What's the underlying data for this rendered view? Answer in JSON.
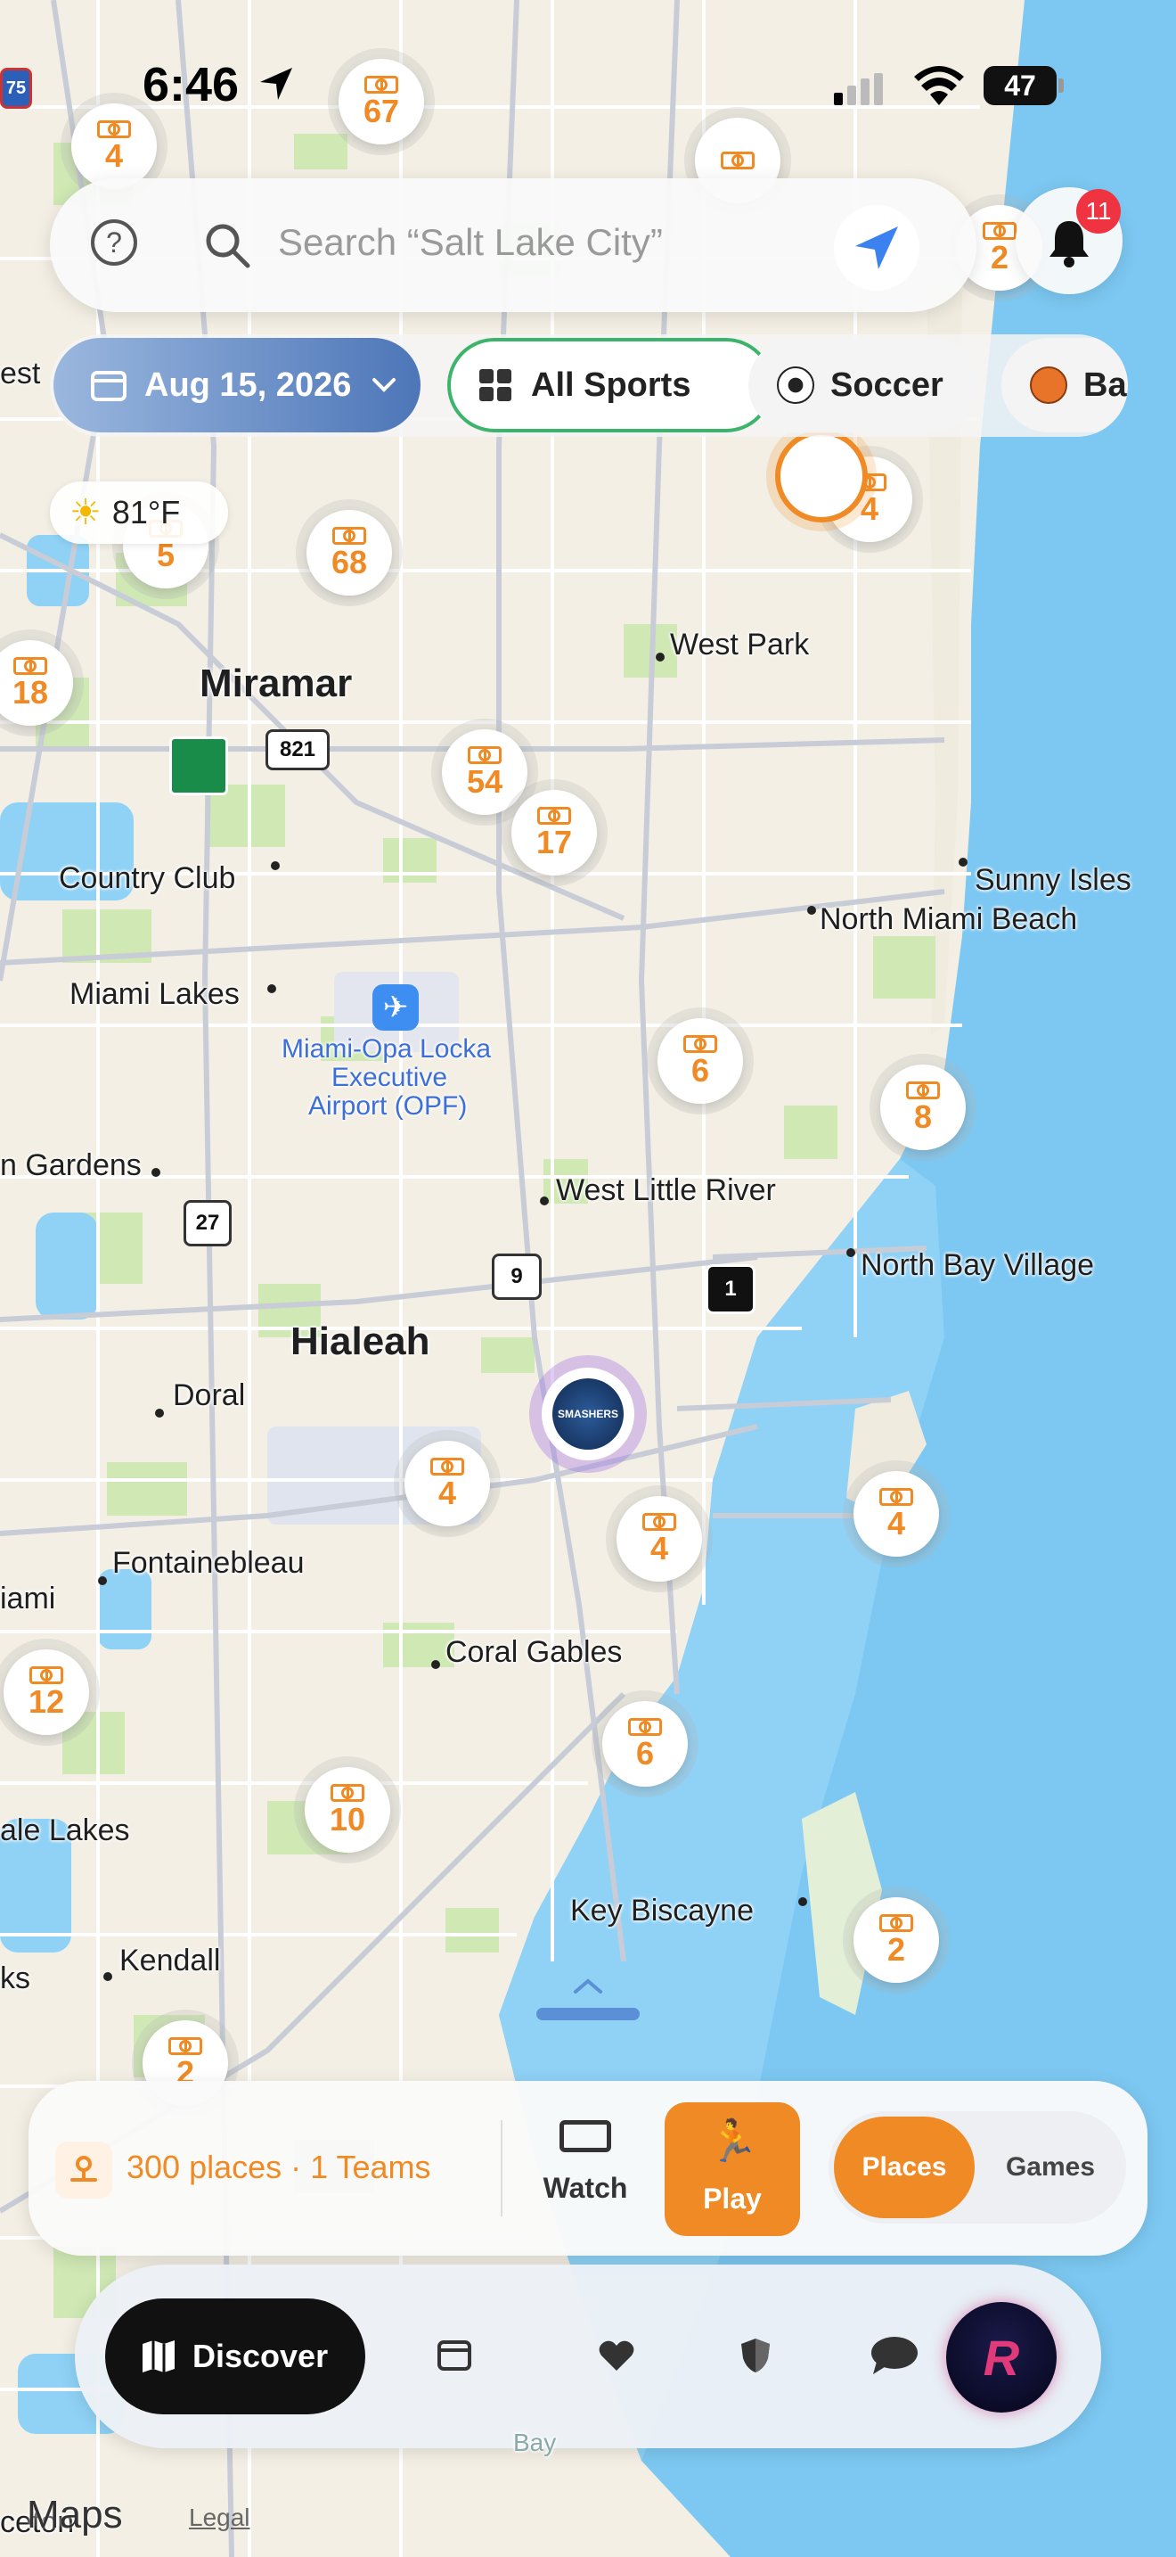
{
  "status_bar": {
    "time": "6:46",
    "battery": "47"
  },
  "search": {
    "placeholder": "Search “Salt Lake City”"
  },
  "notifications": {
    "count": "11"
  },
  "filters": {
    "date": "Aug 15, 2026",
    "chips": [
      "All Sports",
      "Soccer",
      "Ba"
    ]
  },
  "weather": {
    "temp": "81°F"
  },
  "map": {
    "cities": [
      "Miramar",
      "West Park",
      "Country Club",
      "Sunny Isles",
      "North Miami Beach",
      "Miami Lakes",
      "Miami-Opa Locka",
      "Executive",
      "Airport (OPF)",
      "n Gardens",
      "West Little River",
      "North Bay Village",
      "Hialeah",
      "Doral",
      "Fontainebleau",
      "iami",
      "Coral Gables",
      "ale Lakes",
      "Key Biscayne",
      "Kendall",
      "ks",
      "est",
      "ceton",
      "Bay"
    ],
    "clusters": [
      "67",
      "4",
      "2",
      "4",
      "5",
      "68",
      "18",
      "54",
      "17",
      "6",
      "8",
      "4",
      "4",
      "4",
      "12",
      "6",
      "10",
      "2",
      "2"
    ],
    "highways": [
      "75",
      "821",
      "27",
      "9",
      "1"
    ],
    "team_pin": "SMASHERS",
    "attribution": {
      "maps": "Maps",
      "legal": "Legal"
    }
  },
  "summary": {
    "count_text": "300 places · 1 Teams",
    "watch": "Watch",
    "play": "Play",
    "toggle": [
      "Places",
      "Games"
    ]
  },
  "tabbar": {
    "discover": "Discover"
  },
  "colors": {
    "accent": "#f08a24",
    "water": "#7cc8f2",
    "green_border": "#3db46b",
    "badge": "#ef3340"
  }
}
